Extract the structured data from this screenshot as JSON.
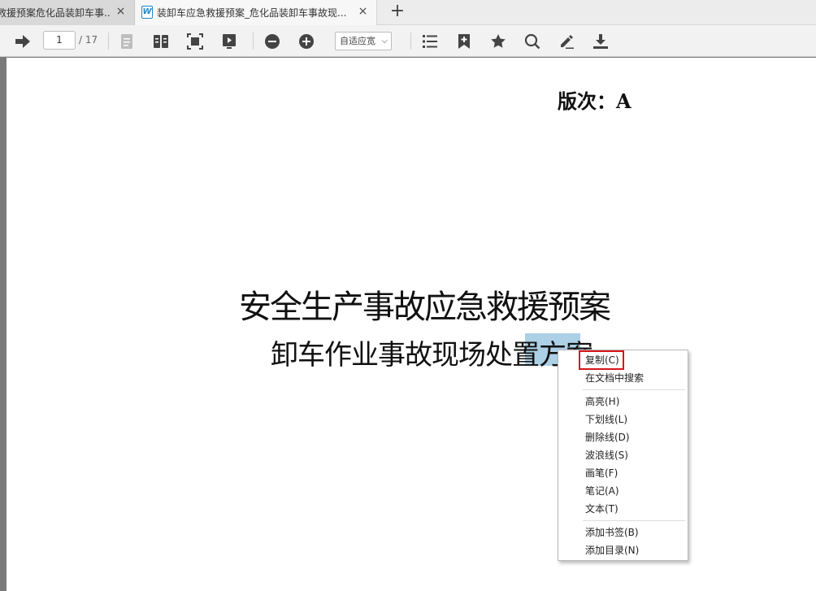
{
  "tabs": [
    {
      "title": "救援预案危化品装卸车事...",
      "active": false
    },
    {
      "title": "装卸车应急救援预案_危化品装卸车事故现...",
      "active": true
    }
  ],
  "tab_close_glyph": "×",
  "new_tab_glyph": "+",
  "doc_icon_letter": "W",
  "toolbar": {
    "current_page": "1",
    "total_pages": "/ 17",
    "zoom": "自适应宽",
    "zoom_caret": "⌵",
    "icons": [
      "go-page-icon",
      "single-page-icon",
      "two-page-icon",
      "fit-page-icon",
      "presentation-icon",
      "zoom-out-icon",
      "zoom-in-icon",
      "outline-icon",
      "add-bookmark-icon",
      "favorite-icon",
      "search-icon",
      "annotate-icon",
      "download-icon"
    ]
  },
  "page": {
    "version": "版次：A",
    "title": "安全生产事故应急救援预案",
    "subtitle": "卸车作业事故现场处置方案",
    "selected_text": "方案"
  },
  "context_menu": {
    "items": [
      {
        "label": "复制(C)",
        "highlighted": true
      },
      {
        "label": "在文档中搜索"
      },
      {
        "label": "高亮(H)"
      },
      {
        "label": "下划线(L)"
      },
      {
        "label": "删除线(D)"
      },
      {
        "label": "波浪线(S)"
      },
      {
        "label": "画笔(F)"
      },
      {
        "label": "笔记(A)"
      },
      {
        "label": "文本(T)"
      },
      {
        "label": "添加书签(B)"
      },
      {
        "label": "添加目录(N)"
      }
    ]
  },
  "colors": {
    "selection": "#9cc3d8",
    "highlight_box": "#d9141c",
    "tab_icon": "#1e88c8"
  }
}
